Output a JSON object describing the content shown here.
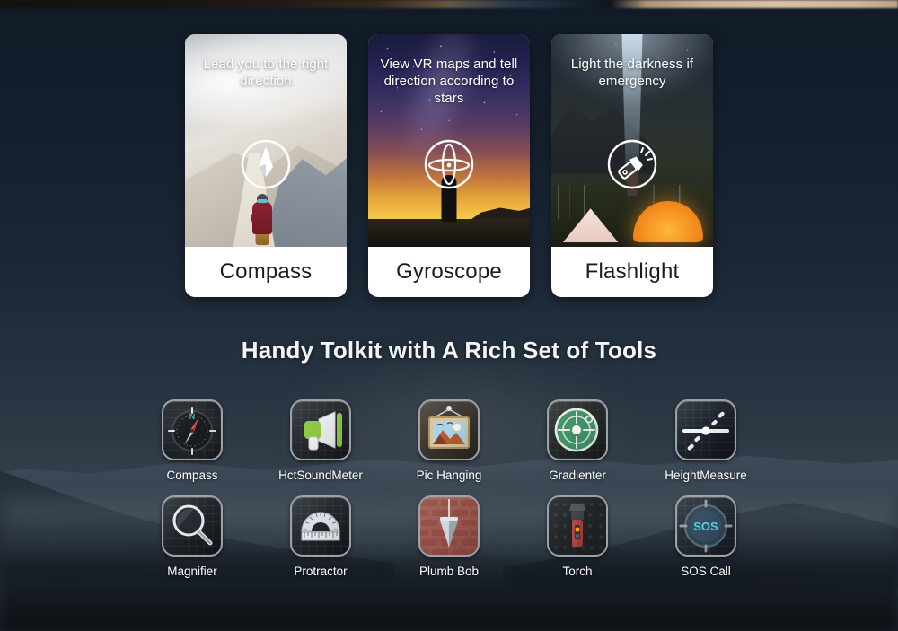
{
  "page": {
    "background_color": "#141d2b",
    "section_title": "Handy Tolkit with A Rich Set of Tools"
  },
  "feature_cards": [
    {
      "caption": "Lead you to the right direction",
      "label": "Compass",
      "glyph": "compass-glyph",
      "scene": "snowy-mountain-climber"
    },
    {
      "caption": "View VR maps and tell direction according to stars",
      "label": "Gyroscope",
      "glyph": "gyroscope-glyph",
      "scene": "starry-sunset-silhouette"
    },
    {
      "caption": "Light the darkness if emergency",
      "label": "Flashlight",
      "glyph": "flashlight-glyph",
      "scene": "night-camping-tents"
    }
  ],
  "tools": {
    "row1": [
      {
        "label": "Compass",
        "icon": "compass-app-icon"
      },
      {
        "label": "HctSoundMeter",
        "icon": "megaphone-app-icon"
      },
      {
        "label": "Pic Hanging",
        "icon": "picture-frame-app-icon"
      },
      {
        "label": "Gradienter",
        "icon": "bubble-level-app-icon"
      },
      {
        "label": "HeightMeasure",
        "icon": "height-measure-app-icon"
      }
    ],
    "row2": [
      {
        "label": "Magnifier",
        "icon": "magnifier-app-icon"
      },
      {
        "label": "Protractor",
        "icon": "protractor-app-icon"
      },
      {
        "label": "Plumb Bob",
        "icon": "plumb-bob-app-icon"
      },
      {
        "label": "Torch",
        "icon": "torch-app-icon"
      },
      {
        "label": "SOS Call",
        "icon": "sos-app-icon",
        "badge_text": "SOS"
      }
    ]
  },
  "colors": {
    "card_surface": "#ffffff",
    "card_label_text": "#1c1c1c",
    "heading_text": "#f2f4f6",
    "tool_label_text": "#ffffff",
    "compass_north_accent": "#35b5b0",
    "compass_needle_red": "#d8342c",
    "sos_accent": "#4fd2e0",
    "gradienter_green": "#3f8f63"
  }
}
